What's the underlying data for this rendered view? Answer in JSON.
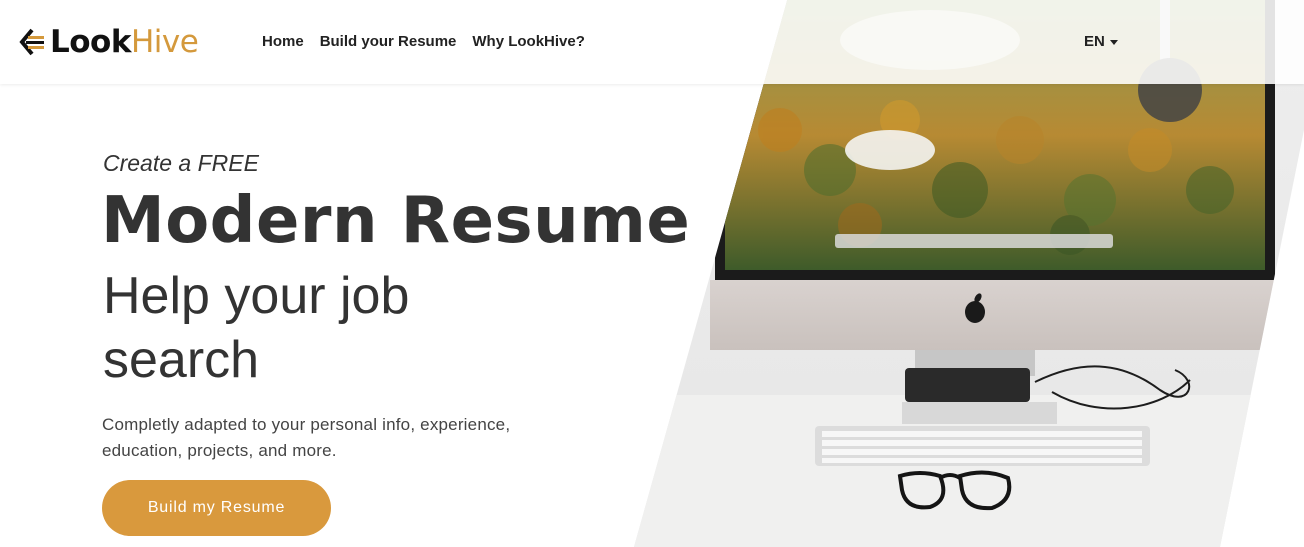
{
  "brand": {
    "logo_icon": "arrow-logo-icon",
    "name_part1": "Look",
    "name_part2": "Hive",
    "accent_color": "#d4993c"
  },
  "nav": {
    "items": [
      {
        "label": "Home"
      },
      {
        "label": "Build your Resume"
      },
      {
        "label": "Why LookHive?"
      }
    ],
    "language": {
      "label": "EN",
      "icon": "caret-down-icon"
    }
  },
  "hero": {
    "pre_title": "Create a FREE",
    "title": "Modern Resume",
    "subtitle": "Help your job search",
    "description": "Completly adapted to your personal info, experience, education, projects, and more.",
    "cta_label": "Build my Resume",
    "cta_color": "#d9993d"
  },
  "hero_image": {
    "subject": "desk-with-imac-photo"
  }
}
